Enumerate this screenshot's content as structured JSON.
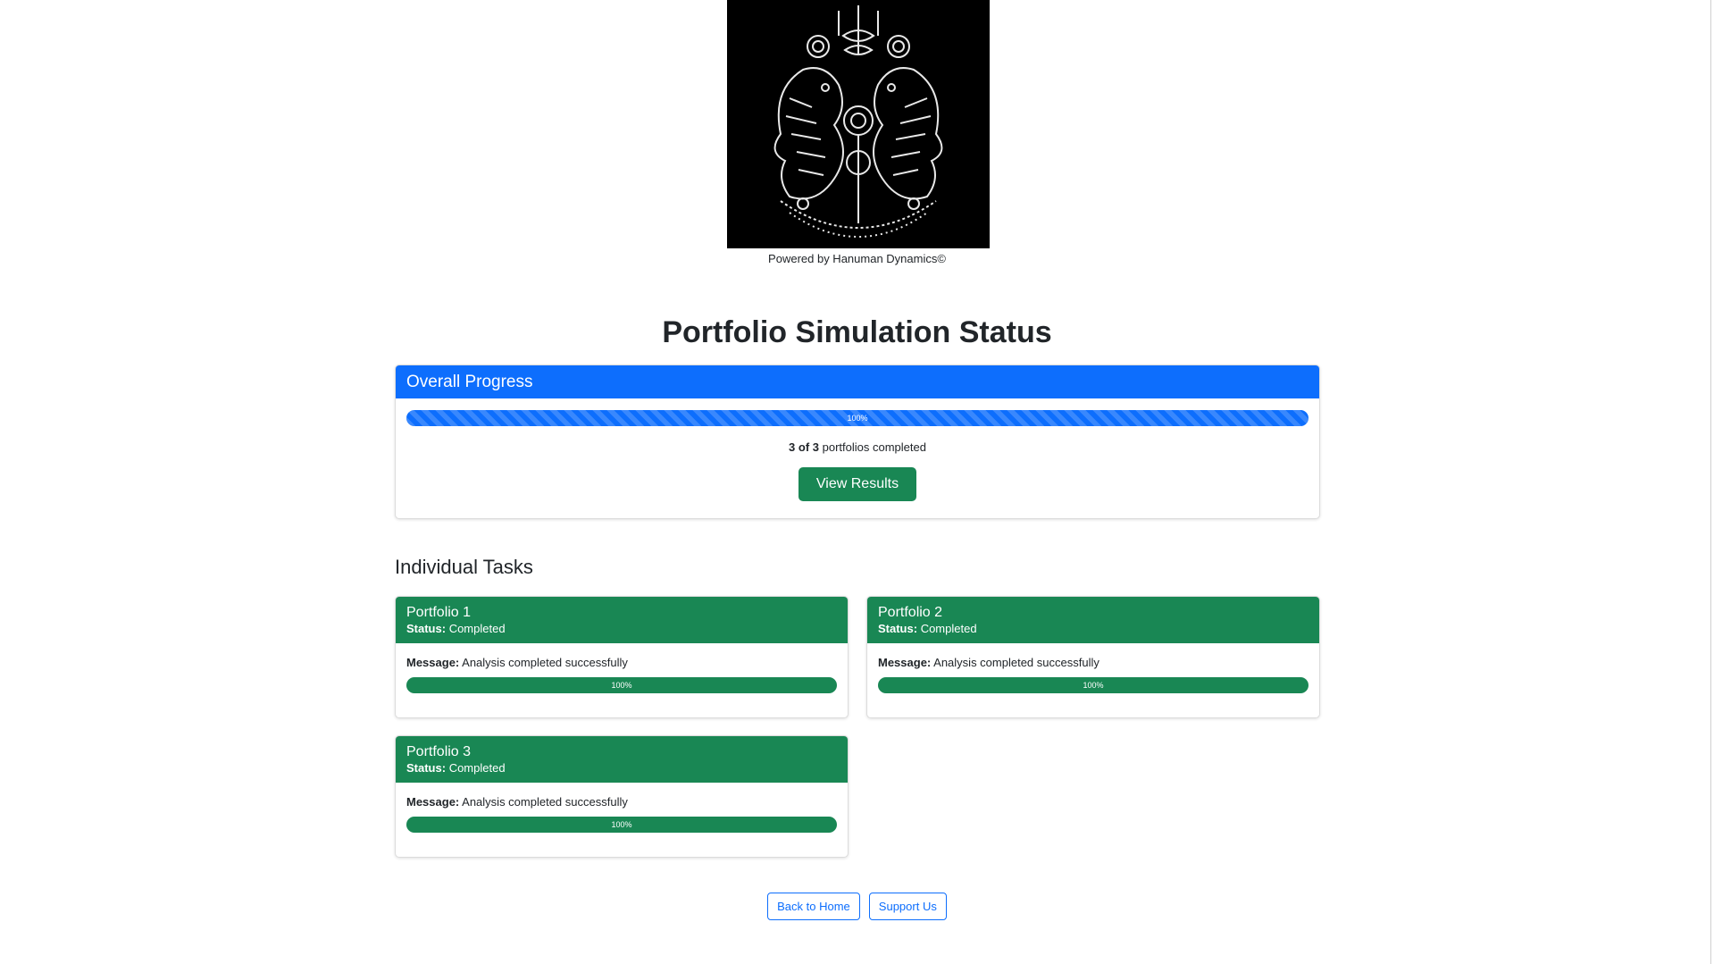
{
  "logo": {
    "alt": "tiger-emblem"
  },
  "powered_by": "Powered by Hanuman Dynamics©",
  "page_title": "Portfolio Simulation Status",
  "overall": {
    "header": "Overall Progress",
    "progress": 1.0,
    "progress_label": "100%",
    "completed_count": "3 of 3",
    "completed_suffix": " portfolios completed",
    "view_results_label": "View Results",
    "accent_color": "#0d6efd"
  },
  "tasks_section_title": "Individual Tasks",
  "status_label": "Status:",
  "message_label": "Message:",
  "tasks": [
    {
      "name": "Portfolio 1",
      "status": "Completed",
      "message": "Analysis completed successfully",
      "progress": 1.0,
      "progress_label": "100%"
    },
    {
      "name": "Portfolio 2",
      "status": "Completed",
      "message": "Analysis completed successfully",
      "progress": 1.0,
      "progress_label": "100%"
    },
    {
      "name": "Portfolio 3",
      "status": "Completed",
      "message": "Analysis completed successfully",
      "progress": 1.0,
      "progress_label": "100%"
    }
  ],
  "task_color": "#198754",
  "footer_buttons": {
    "back_home": "Back to Home",
    "support": "Support Us"
  }
}
